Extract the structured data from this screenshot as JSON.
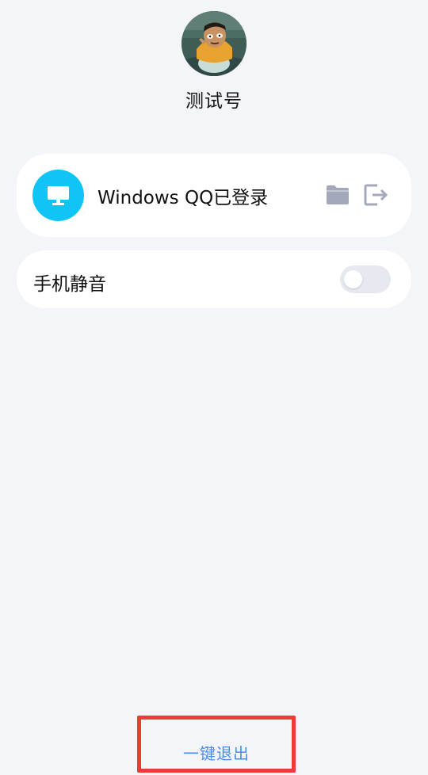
{
  "profile": {
    "username": "测试号",
    "avatar_icon": "cartoon-avatar"
  },
  "device": {
    "icon": "desktop-monitor-icon",
    "label": "Windows QQ已登录",
    "actions": {
      "folder_icon": "folder-icon",
      "logout_icon": "logout-icon"
    }
  },
  "mute": {
    "label": "手机静音",
    "enabled": false
  },
  "footer": {
    "exit_label": "一键退出"
  },
  "colors": {
    "background": "#f4f5f9",
    "card": "#ffffff",
    "device_icon_bg": "#10c4f5",
    "action_icon": "#a3a9ba",
    "link_blue": "#4a8cf0",
    "highlight_border": "#ef3a3a",
    "toggle_track": "#e6e9f0"
  }
}
